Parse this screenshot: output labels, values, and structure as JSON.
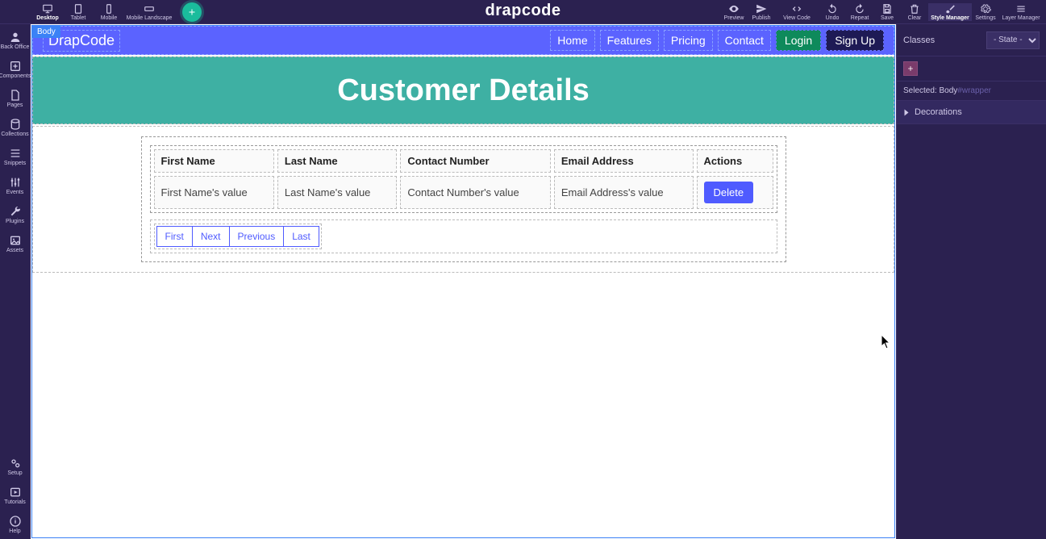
{
  "topbar": {
    "devices": [
      {
        "label": "Desktop",
        "icon": "monitor",
        "active": true
      },
      {
        "label": "Tablet",
        "icon": "tablet"
      },
      {
        "label": "Mobile",
        "icon": "mobile"
      },
      {
        "label": "Mobile Landscape",
        "icon": "mobile-land",
        "wide": true
      }
    ],
    "brand": "drapcode",
    "tools": [
      {
        "label": "Preview",
        "icon": "eye"
      },
      {
        "label": "Publish",
        "icon": "send"
      },
      {
        "label": "View Code",
        "icon": "code",
        "wide": true
      },
      {
        "label": "Undo",
        "icon": "undo"
      },
      {
        "label": "Repeat",
        "icon": "redo"
      },
      {
        "label": "Save",
        "icon": "save"
      },
      {
        "label": "Clear",
        "icon": "trash"
      },
      {
        "label": "Style Manager",
        "icon": "brush",
        "wide": true,
        "active": true
      },
      {
        "label": "Settings",
        "icon": "gear"
      },
      {
        "label": "Layer Manager",
        "icon": "layers",
        "wide": true
      }
    ]
  },
  "leftbar": {
    "top": [
      {
        "label": "Back Office",
        "icon": "user"
      },
      {
        "label": "Components",
        "icon": "plus-box"
      },
      {
        "label": "Pages",
        "icon": "file"
      },
      {
        "label": "Collections",
        "icon": "db"
      },
      {
        "label": "Snippets",
        "icon": "lines"
      },
      {
        "label": "Events",
        "icon": "sliders"
      },
      {
        "label": "Plugins",
        "icon": "wrench"
      },
      {
        "label": "Assets",
        "icon": "image"
      }
    ],
    "bottom": [
      {
        "label": "Setup",
        "icon": "gears"
      },
      {
        "label": "Tutorials",
        "icon": "play"
      },
      {
        "label": "Help",
        "icon": "info"
      }
    ]
  },
  "canvas": {
    "body_tag": "Body",
    "page_brand": "DrapCode",
    "nav_links": [
      "Home",
      "Features",
      "Pricing",
      "Contact"
    ],
    "nav_login": "Login",
    "nav_signup": "Sign Up",
    "hero_title": "Customer Details",
    "table": {
      "headers": [
        "First Name",
        "Last Name",
        "Contact Number",
        "Email Address",
        "Actions"
      ],
      "row": [
        "First Name's value",
        "Last Name's value",
        "Contact Number's value",
        "Email Address's value"
      ],
      "action_label": "Delete"
    },
    "pagination": [
      "First",
      "Next",
      "Previous",
      "Last"
    ]
  },
  "rightbar": {
    "classes_label": "Classes",
    "state_label": "- State -",
    "selected_prefix": "Selected:",
    "selected_el": "Body",
    "selected_id": "#wrapper",
    "group1": "Decorations"
  }
}
